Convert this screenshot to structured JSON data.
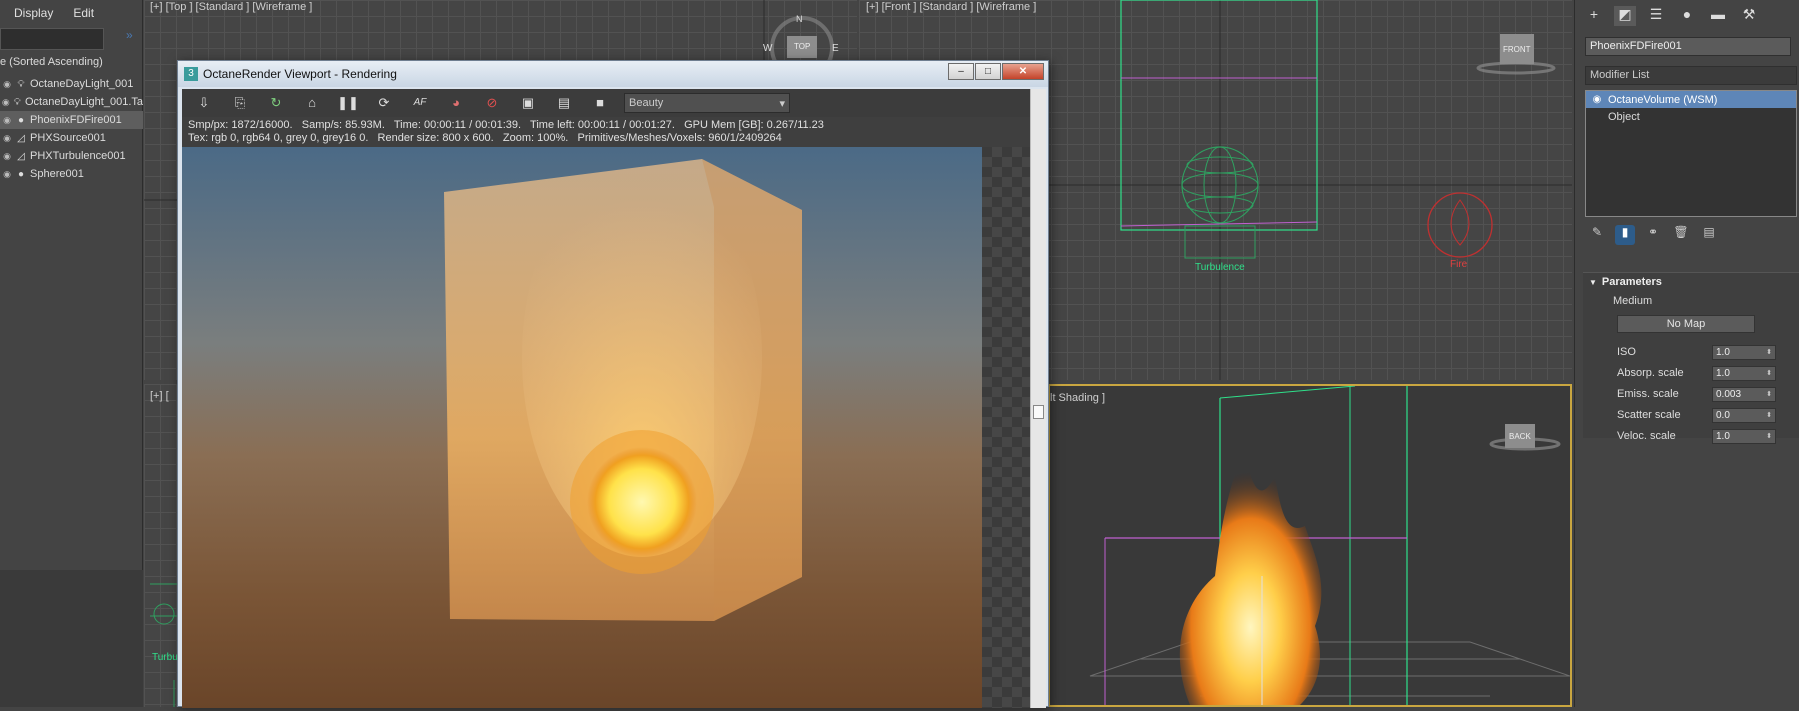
{
  "explorer": {
    "menu": [
      "Display",
      "Edit"
    ],
    "sort_label": "e (Sorted Ascending)",
    "items": [
      {
        "label": "OctaneDayLight_001",
        "icon": "light",
        "selected": false
      },
      {
        "label": "OctaneDayLight_001.Ta",
        "icon": "light",
        "selected": false
      },
      {
        "label": "PhoenixFDFire001",
        "icon": "sphere",
        "selected": true
      },
      {
        "label": "PHXSource001",
        "icon": "helper",
        "selected": false
      },
      {
        "label": "PHXTurbulence001",
        "icon": "helper",
        "selected": false
      },
      {
        "label": "Sphere001",
        "icon": "sphere",
        "selected": false
      }
    ]
  },
  "viewports": {
    "top": {
      "label": "[+] [Top ] [Standard ] [Wireframe ]",
      "cube": "TOP",
      "compass": {
        "n": "N",
        "w": "W",
        "e": "E"
      }
    },
    "front": {
      "label": "[+] [Front ] [Standard ] [Wireframe ]",
      "cube": "FRONT",
      "labels": {
        "turbulence": "Turbulence",
        "fire": "Fire"
      }
    },
    "left": {
      "label": "[+] [",
      "partial_label": "Turbu"
    },
    "persp": {
      "label": "lt Shading ]",
      "cube": "BACK"
    }
  },
  "octane": {
    "title": "OctaneRender Viewport - Rendering",
    "window_buttons": {
      "minimize": "–",
      "maximize": "□",
      "close": "✕"
    },
    "pass": "Beauty",
    "stats_line1": "Smp/px: 1872/16000.   Samp/s: 85.93M.   Time: 00:00:11 / 00:01:39.   Time left: 00:00:11 / 00:01:27.   GPU Mem [GB]: 0.267/11.23",
    "stats_line2": "Tex: rgb 0, rgb64 0, grey 0, grey16 0.   Render size: 800 x 600.   Zoom: 100%.   Primitives/Meshes/Voxels: 960/1/2409264",
    "toolbar": [
      {
        "name": "export-icon",
        "glyph": "⇩"
      },
      {
        "name": "copy-icon",
        "glyph": "⎘"
      },
      {
        "name": "restart-icon",
        "glyph": "↻"
      },
      {
        "name": "lock-icon",
        "glyph": "⌂"
      },
      {
        "name": "pause-icon",
        "glyph": "❚❚"
      },
      {
        "name": "refresh-icon",
        "glyph": "⟳"
      },
      {
        "name": "af-icon",
        "glyph": "AF"
      },
      {
        "name": "color-picker-icon",
        "glyph": "◕"
      },
      {
        "name": "clear-icon",
        "glyph": "⊘"
      },
      {
        "name": "region-icon",
        "glyph": "▣"
      },
      {
        "name": "save-icon",
        "glyph": "▤"
      },
      {
        "name": "camera-icon",
        "glyph": "■"
      }
    ]
  },
  "command_panel": {
    "tabs": [
      {
        "name": "create-tab-icon",
        "glyph": "+"
      },
      {
        "name": "modify-tab-icon",
        "glyph": "◩"
      },
      {
        "name": "hierarchy-tab-icon",
        "glyph": "☰"
      },
      {
        "name": "motion-tab-icon",
        "glyph": "●"
      },
      {
        "name": "display-tab-icon",
        "glyph": "▬"
      },
      {
        "name": "utilities-tab-icon",
        "glyph": "⚒"
      }
    ],
    "object_name": "PhoenixFDFire001",
    "modifier_list": "Modifier List",
    "stack": [
      {
        "label": "OctaneVolume (WSM)",
        "selected": true
      },
      {
        "label": "Object",
        "selected": false
      }
    ],
    "rollout_title": "Parameters",
    "medium_label": "Medium",
    "no_map": "No Map",
    "params": [
      {
        "label": "ISO",
        "value": "1.0"
      },
      {
        "label": "Absorp. scale",
        "value": "1.0"
      },
      {
        "label": "Emiss. scale",
        "value": "0.003"
      },
      {
        "label": "Scatter scale",
        "value": "0.0"
      },
      {
        "label": "Veloc. scale",
        "value": "1.0"
      }
    ]
  },
  "colors": {
    "accent": "#5e86b8",
    "active_viewport": "#c9a640",
    "wire_green": "#2fa060",
    "wire_magenta": "#c060d0",
    "fire_red": "#c03030"
  }
}
